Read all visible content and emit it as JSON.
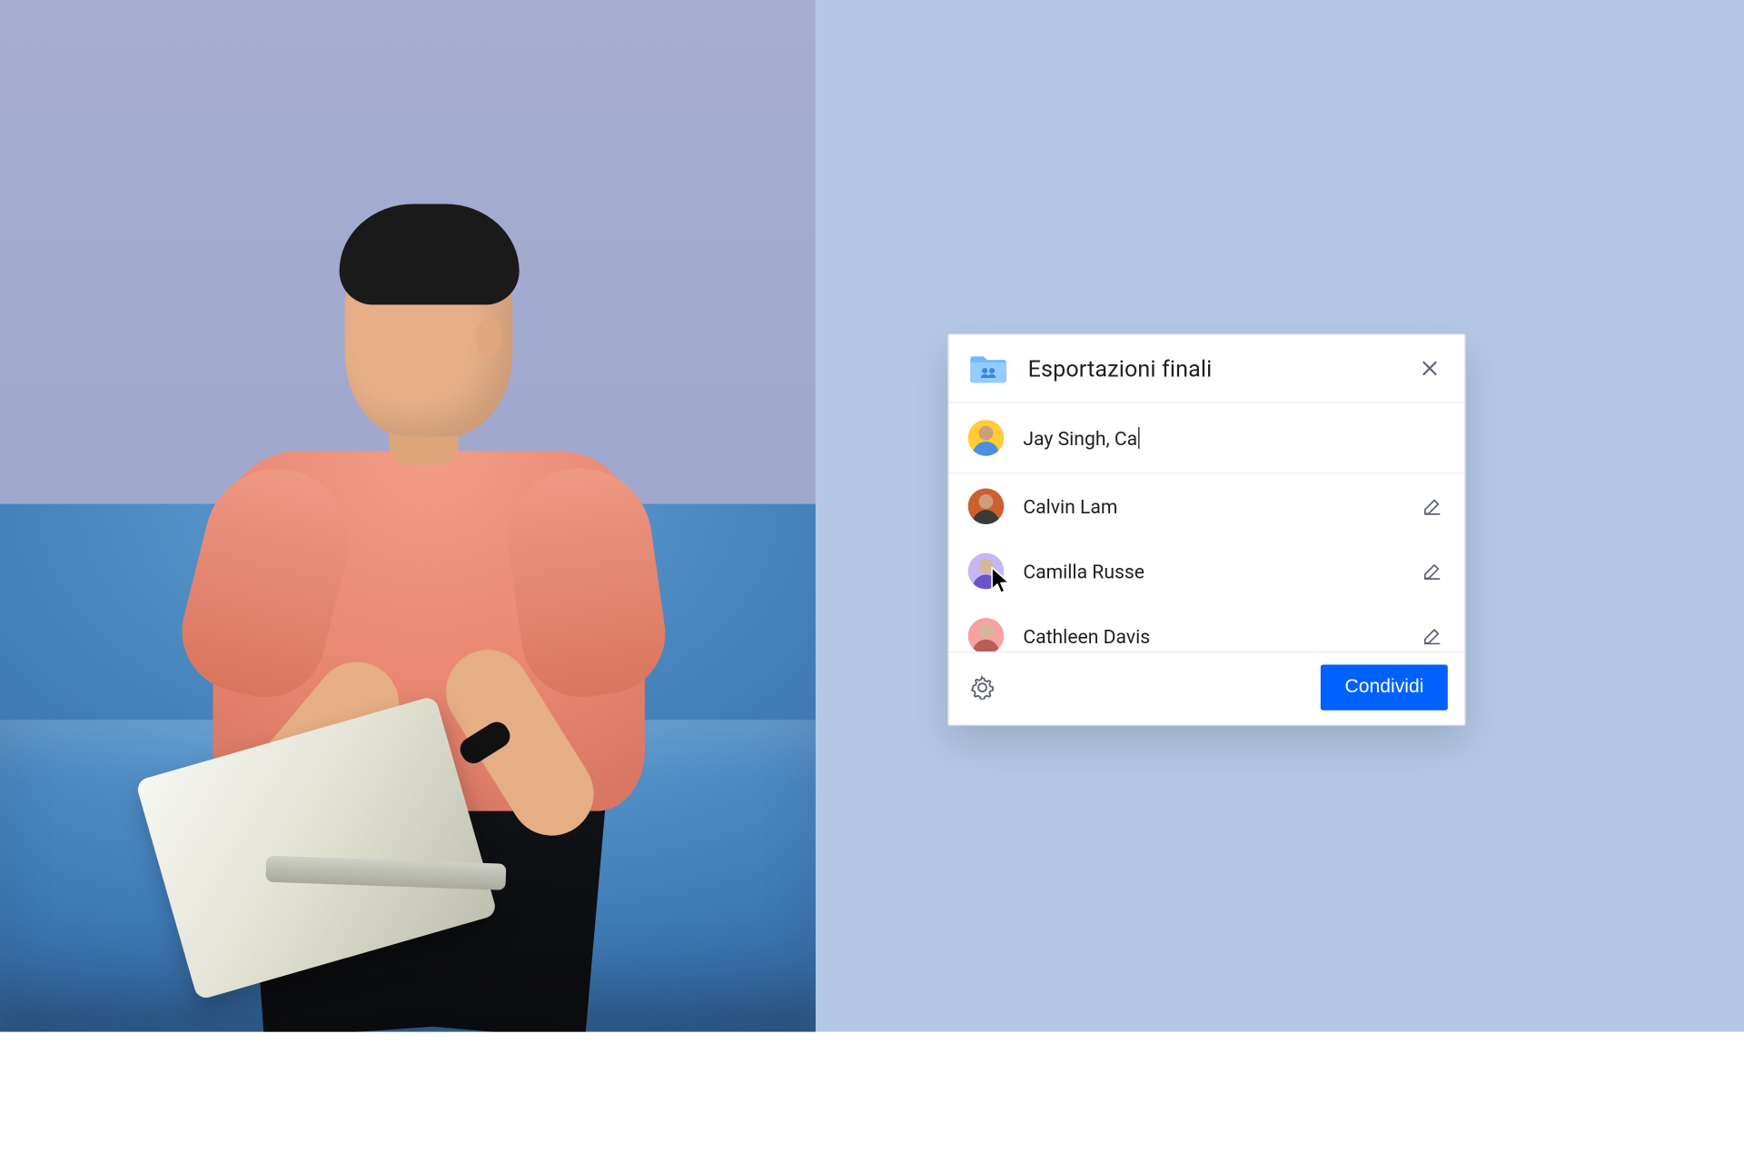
{
  "folder_name": "Esportazioni finali",
  "input_value": "Jay Singh, Ca",
  "suggestions": [
    {
      "name": "Calvin Lam",
      "avatar": "orange"
    },
    {
      "name": "Camilla Russe",
      "avatar": "lilac"
    },
    {
      "name": "Cathleen Davis",
      "avatar": "pink"
    }
  ],
  "share_button_label": "Condividi",
  "icons": {
    "folder": "shared-folder-icon",
    "close": "close-icon",
    "edit": "pencil-icon",
    "settings": "gear-icon"
  },
  "colors": {
    "panel_bg": "#b4c8e4",
    "primary": "#0061fe"
  }
}
